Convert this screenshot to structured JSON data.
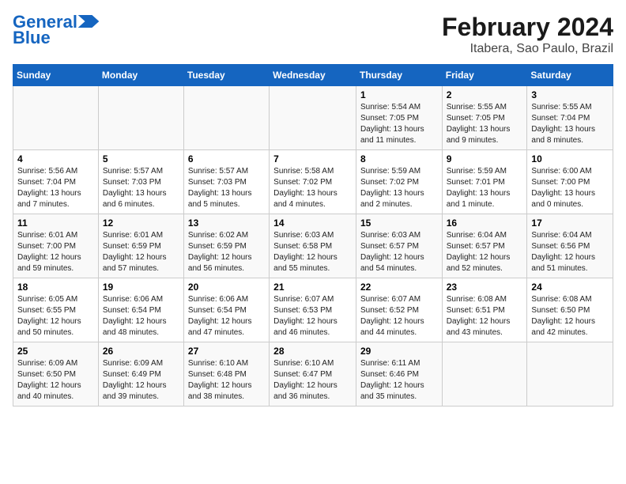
{
  "logo": {
    "line1": "General",
    "line2": "Blue"
  },
  "title": "February 2024",
  "subtitle": "Itabera, Sao Paulo, Brazil",
  "weekdays": [
    "Sunday",
    "Monday",
    "Tuesday",
    "Wednesday",
    "Thursday",
    "Friday",
    "Saturday"
  ],
  "weeks": [
    [
      {
        "day": "",
        "info": ""
      },
      {
        "day": "",
        "info": ""
      },
      {
        "day": "",
        "info": ""
      },
      {
        "day": "",
        "info": ""
      },
      {
        "day": "1",
        "info": "Sunrise: 5:54 AM\nSunset: 7:05 PM\nDaylight: 13 hours and 11 minutes."
      },
      {
        "day": "2",
        "info": "Sunrise: 5:55 AM\nSunset: 7:05 PM\nDaylight: 13 hours and 9 minutes."
      },
      {
        "day": "3",
        "info": "Sunrise: 5:55 AM\nSunset: 7:04 PM\nDaylight: 13 hours and 8 minutes."
      }
    ],
    [
      {
        "day": "4",
        "info": "Sunrise: 5:56 AM\nSunset: 7:04 PM\nDaylight: 13 hours and 7 minutes."
      },
      {
        "day": "5",
        "info": "Sunrise: 5:57 AM\nSunset: 7:03 PM\nDaylight: 13 hours and 6 minutes."
      },
      {
        "day": "6",
        "info": "Sunrise: 5:57 AM\nSunset: 7:03 PM\nDaylight: 13 hours and 5 minutes."
      },
      {
        "day": "7",
        "info": "Sunrise: 5:58 AM\nSunset: 7:02 PM\nDaylight: 13 hours and 4 minutes."
      },
      {
        "day": "8",
        "info": "Sunrise: 5:59 AM\nSunset: 7:02 PM\nDaylight: 13 hours and 2 minutes."
      },
      {
        "day": "9",
        "info": "Sunrise: 5:59 AM\nSunset: 7:01 PM\nDaylight: 13 hours and 1 minute."
      },
      {
        "day": "10",
        "info": "Sunrise: 6:00 AM\nSunset: 7:00 PM\nDaylight: 13 hours and 0 minutes."
      }
    ],
    [
      {
        "day": "11",
        "info": "Sunrise: 6:01 AM\nSunset: 7:00 PM\nDaylight: 12 hours and 59 minutes."
      },
      {
        "day": "12",
        "info": "Sunrise: 6:01 AM\nSunset: 6:59 PM\nDaylight: 12 hours and 57 minutes."
      },
      {
        "day": "13",
        "info": "Sunrise: 6:02 AM\nSunset: 6:59 PM\nDaylight: 12 hours and 56 minutes."
      },
      {
        "day": "14",
        "info": "Sunrise: 6:03 AM\nSunset: 6:58 PM\nDaylight: 12 hours and 55 minutes."
      },
      {
        "day": "15",
        "info": "Sunrise: 6:03 AM\nSunset: 6:57 PM\nDaylight: 12 hours and 54 minutes."
      },
      {
        "day": "16",
        "info": "Sunrise: 6:04 AM\nSunset: 6:57 PM\nDaylight: 12 hours and 52 minutes."
      },
      {
        "day": "17",
        "info": "Sunrise: 6:04 AM\nSunset: 6:56 PM\nDaylight: 12 hours and 51 minutes."
      }
    ],
    [
      {
        "day": "18",
        "info": "Sunrise: 6:05 AM\nSunset: 6:55 PM\nDaylight: 12 hours and 50 minutes."
      },
      {
        "day": "19",
        "info": "Sunrise: 6:06 AM\nSunset: 6:54 PM\nDaylight: 12 hours and 48 minutes."
      },
      {
        "day": "20",
        "info": "Sunrise: 6:06 AM\nSunset: 6:54 PM\nDaylight: 12 hours and 47 minutes."
      },
      {
        "day": "21",
        "info": "Sunrise: 6:07 AM\nSunset: 6:53 PM\nDaylight: 12 hours and 46 minutes."
      },
      {
        "day": "22",
        "info": "Sunrise: 6:07 AM\nSunset: 6:52 PM\nDaylight: 12 hours and 44 minutes."
      },
      {
        "day": "23",
        "info": "Sunrise: 6:08 AM\nSunset: 6:51 PM\nDaylight: 12 hours and 43 minutes."
      },
      {
        "day": "24",
        "info": "Sunrise: 6:08 AM\nSunset: 6:50 PM\nDaylight: 12 hours and 42 minutes."
      }
    ],
    [
      {
        "day": "25",
        "info": "Sunrise: 6:09 AM\nSunset: 6:50 PM\nDaylight: 12 hours and 40 minutes."
      },
      {
        "day": "26",
        "info": "Sunrise: 6:09 AM\nSunset: 6:49 PM\nDaylight: 12 hours and 39 minutes."
      },
      {
        "day": "27",
        "info": "Sunrise: 6:10 AM\nSunset: 6:48 PM\nDaylight: 12 hours and 38 minutes."
      },
      {
        "day": "28",
        "info": "Sunrise: 6:10 AM\nSunset: 6:47 PM\nDaylight: 12 hours and 36 minutes."
      },
      {
        "day": "29",
        "info": "Sunrise: 6:11 AM\nSunset: 6:46 PM\nDaylight: 12 hours and 35 minutes."
      },
      {
        "day": "",
        "info": ""
      },
      {
        "day": "",
        "info": ""
      }
    ]
  ]
}
